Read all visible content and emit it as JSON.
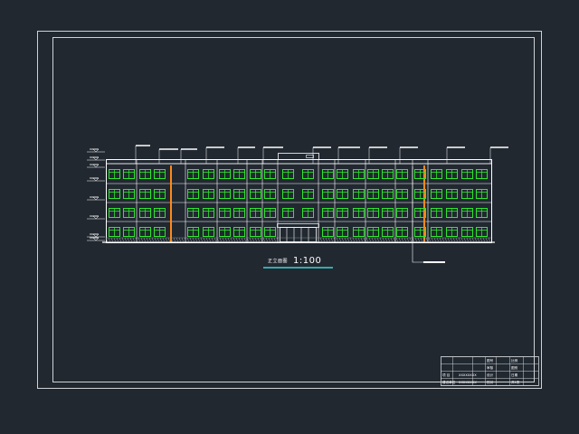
{
  "drawing": {
    "title": "正立面图",
    "scale": "1:100",
    "floors": 4,
    "colors": {
      "background": "#212830",
      "border": "#cfd2d6",
      "outline": "#ffffff",
      "window": "#2fe62f",
      "accent": "#ff8a1a",
      "underline": "#41d2d9",
      "ground": "#9aa0a6"
    }
  },
  "title_block": {
    "rows": [
      [
        "",
        "",
        "",
        "图号",
        "",
        "比例"
      ],
      [
        "",
        "",
        "",
        "审核",
        "",
        "图别"
      ],
      [
        "项 目",
        "XXXXXXXX",
        "",
        "设计",
        "",
        "日期"
      ],
      [
        "建设单位",
        "XXXXXXXX",
        "",
        "校对",
        "",
        "共1张"
      ]
    ]
  }
}
